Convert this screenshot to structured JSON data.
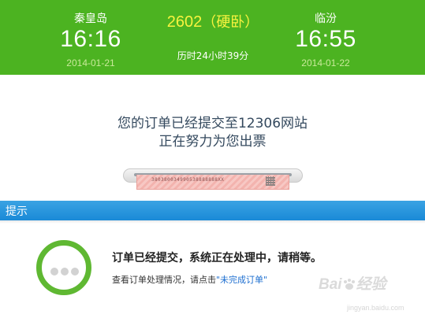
{
  "trip": {
    "from_station": "秦皇岛",
    "from_time": "16:16",
    "from_date": "2014-01-21",
    "to_station": "临汾",
    "to_time": "16:55",
    "to_date": "2014-01-22",
    "train_number": "2602",
    "paren_open": "（",
    "seat_type": "硬卧",
    "paren_close": "）",
    "duration": "历时24小时39分"
  },
  "message": {
    "line1": "您的订单已经提交至12306网站",
    "line2": "正在努力为您出票"
  },
  "ticket": {
    "code": "380380034990538888888XX"
  },
  "tips": {
    "title": "提示",
    "status_title": "订单已经提交，系统正在处理中，请稍等。",
    "hint_prefix": "查看订单处理情况，请点击",
    "hint_link": "\"未完成订单\""
  },
  "watermark": {
    "logo": "Bai",
    "logo_suffix": "经验",
    "sub": "jingyan.baidu.com"
  },
  "colors": {
    "header_green": "#4cb321",
    "train_yellow": "#f8f33f",
    "tips_blue": "#1a8ad7",
    "ring_green": "#5fb832",
    "link_blue": "#1e6fd0"
  },
  "icons": {
    "status": "processing-dots-icon",
    "printer": "ticket-printer-icon"
  }
}
